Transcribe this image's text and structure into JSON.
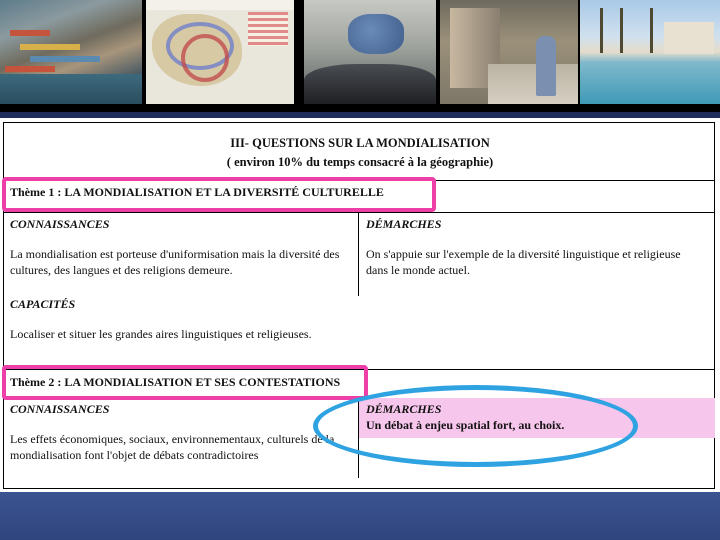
{
  "banner": {
    "photos": [
      {
        "name": "port-container-photo"
      },
      {
        "name": "globalisation-flows-map"
      },
      {
        "name": "car-with-luggage-photo"
      },
      {
        "name": "slum-street-photo"
      },
      {
        "name": "resort-pool-photo"
      }
    ]
  },
  "document": {
    "title": "III- QUESTIONS SUR LA MONDIALISATION",
    "subtitle": "( environ 10% du temps consacré à la géographie)",
    "theme1": {
      "title": "Thème 1 : LA MONDIALISATION ET LA DIVERSITÉ CULTURELLE",
      "connaissances_heading": "CONNAISSANCES",
      "connaissances_text": "La mondialisation est porteuse d'uniformisation mais la diversité des cultures, des langues et des religions demeure.",
      "demarches_heading": "DÉMARCHES",
      "demarches_text": "On s'appuie sur l'exemple de la diversité linguistique et religieuse dans le monde actuel.",
      "capacites_heading": "CAPACITÉS",
      "capacites_text": "Localiser et situer les grandes aires linguistiques et religieuses."
    },
    "theme2": {
      "title": "Thème 2 : LA MONDIALISATION ET SES CONTESTATIONS",
      "connaissances_heading": "CONNAISSANCES",
      "connaissances_text": "Les effets économiques, sociaux, environnementaux, culturels de la mondialisation font l'objet de débats contradictoires",
      "demarches_heading": "DÉMARCHES",
      "demarches_text": "Un débat à enjeu spatial fort, au choix."
    }
  },
  "colors": {
    "highlight_box": "#ee3fa8",
    "highlight_fill": "#f7c6ec",
    "ellipse": "#2fa2e2",
    "footer": "#3c5491"
  }
}
